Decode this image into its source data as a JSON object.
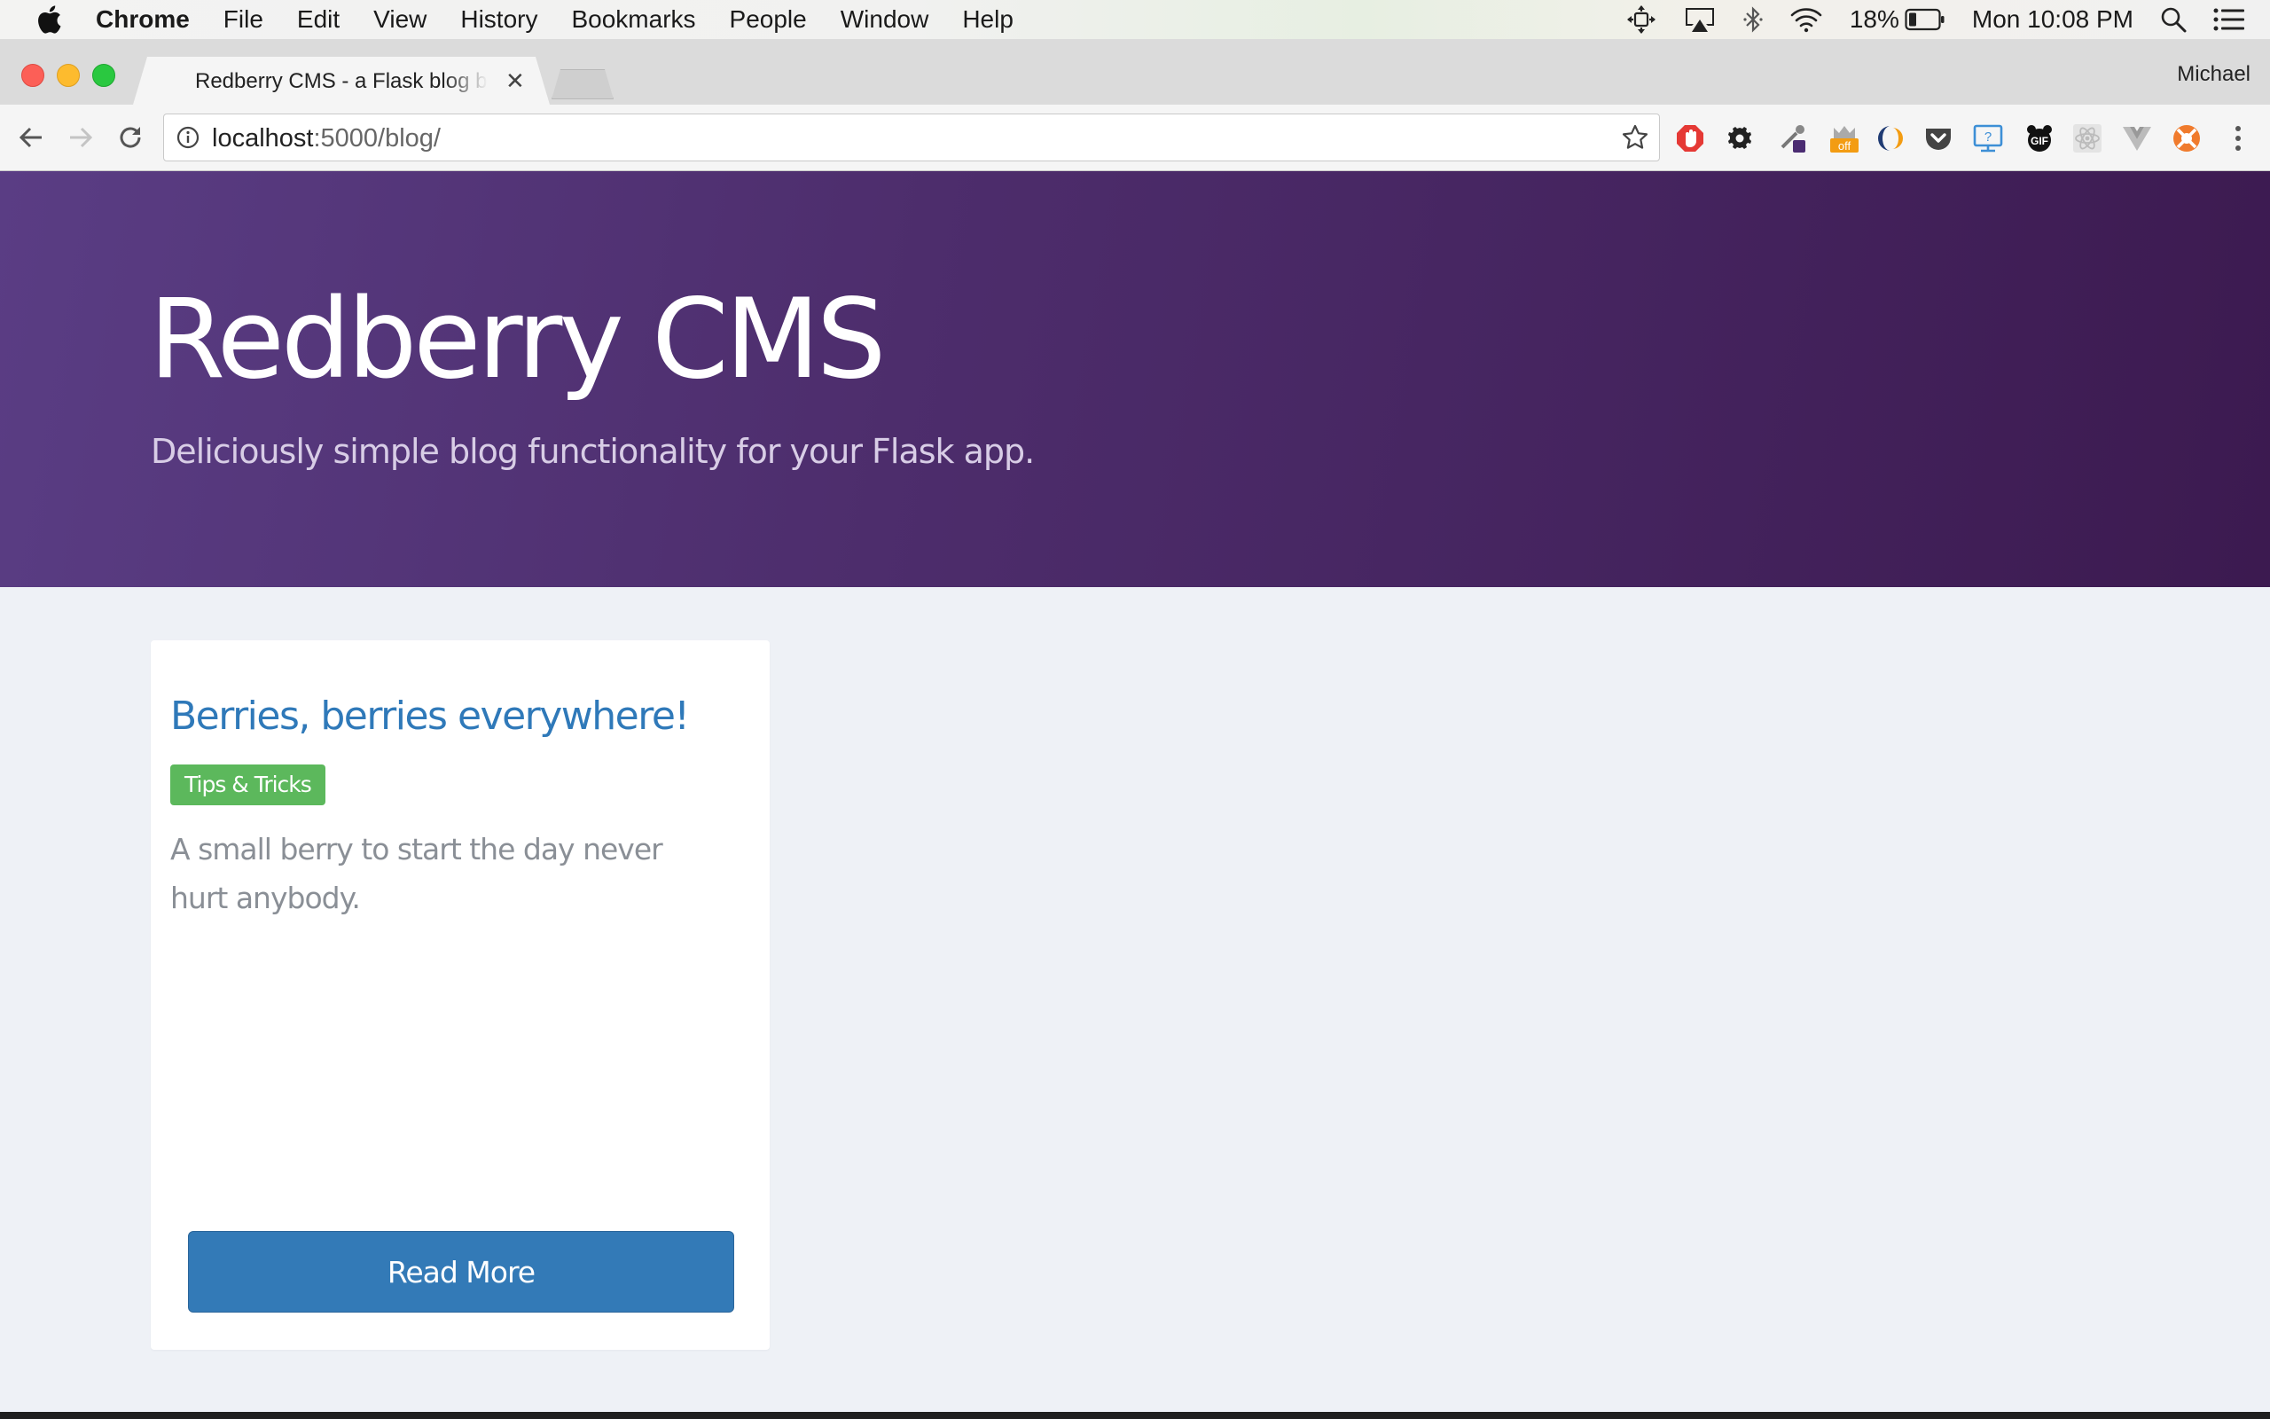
{
  "menubar": {
    "apple_icon": "apple-logo",
    "app_name": "Chrome",
    "items": [
      "File",
      "Edit",
      "View",
      "History",
      "Bookmarks",
      "People",
      "Window",
      "Help"
    ],
    "battery": "18%",
    "clock": "Mon 10:08 PM"
  },
  "browser": {
    "tab_title": "Redberry CMS - a Flask blog b",
    "profile_name": "Michael",
    "url_host": "localhost",
    "url_rest": ":5000/blog/"
  },
  "hero": {
    "title": "Redberry CMS",
    "subtitle": "Deliciously simple blog functionality for your Flask app."
  },
  "post": {
    "title": "Berries, berries everywhere!",
    "category": "Tips & Tricks",
    "excerpt": "A small berry to start the day never hurt anybody.",
    "read_more_label": "Read More"
  },
  "colors": {
    "hero_start": "#5a3d84",
    "hero_end": "#3c1a50",
    "link_blue": "#2f79b9",
    "tag_green": "#5cb85c",
    "button_blue": "#337ab7"
  }
}
